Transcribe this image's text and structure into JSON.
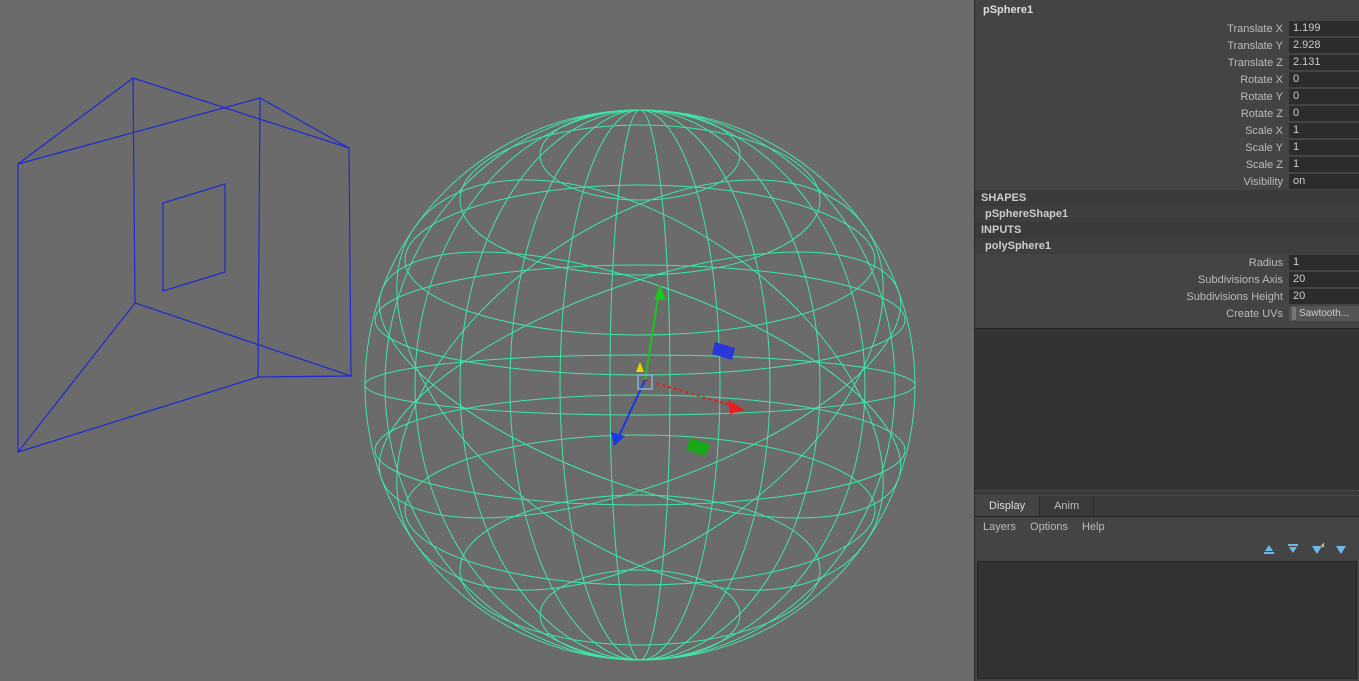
{
  "object": {
    "name": "pSphere1",
    "attrs": [
      {
        "label": "Translate X",
        "value": "1.199"
      },
      {
        "label": "Translate Y",
        "value": "2.928"
      },
      {
        "label": "Translate Z",
        "value": "2.131"
      },
      {
        "label": "Rotate X",
        "value": "0"
      },
      {
        "label": "Rotate Y",
        "value": "0"
      },
      {
        "label": "Rotate Z",
        "value": "0"
      },
      {
        "label": "Scale X",
        "value": "1"
      },
      {
        "label": "Scale Y",
        "value": "1"
      },
      {
        "label": "Scale Z",
        "value": "1"
      },
      {
        "label": "Visibility",
        "value": "on"
      }
    ]
  },
  "shapes": {
    "header": "SHAPES",
    "name": "pSphereShape1"
  },
  "inputs": {
    "header": "INPUTS",
    "name": "polySphere1",
    "attrs": [
      {
        "label": "Radius",
        "value": "1"
      },
      {
        "label": "Subdivisions Axis",
        "value": "20"
      },
      {
        "label": "Subdivisions Height",
        "value": "20"
      }
    ],
    "createUVs": {
      "label": "Create UVs",
      "value": "Sawtooth..."
    }
  },
  "layerPanel": {
    "tabs": [
      {
        "label": "Display",
        "active": true
      },
      {
        "label": "Anim",
        "active": false
      }
    ],
    "menu": [
      "Layers",
      "Options",
      "Help"
    ]
  },
  "colors": {
    "sphere": "#3fe6a5",
    "cube": "#1f2ad1",
    "axisX": "#e81c1c",
    "axisY": "#18c818",
    "axisZ": "#1838e8",
    "center": "#e6d600"
  }
}
